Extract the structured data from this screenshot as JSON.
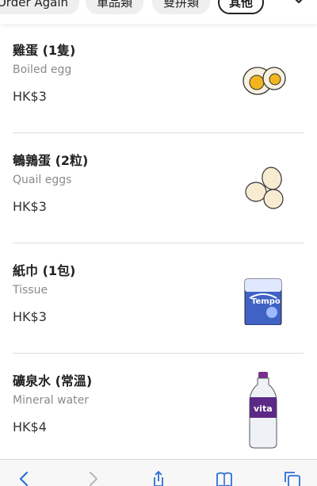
{
  "categories": {
    "tabs": [
      {
        "label": "Order Again"
      },
      {
        "label": "單品類"
      },
      {
        "label": "雙拼類"
      },
      {
        "label": "其他"
      }
    ],
    "active": "其他"
  },
  "items": [
    {
      "name_zh": "雞蛋 (1隻)",
      "name_en": "Boiled egg",
      "price": "HK$3",
      "icon": "boiled-egg-image"
    },
    {
      "name_zh": "鵪鶉蛋 (2粒)",
      "name_en": "Quail eggs",
      "price": "HK$3",
      "icon": "quail-eggs-image"
    },
    {
      "name_zh": "紙巾 (1包)",
      "name_en": "Tissue",
      "price": "HK$3",
      "icon": "tissue-pack-image"
    },
    {
      "name_zh": "礦泉水 (常溫)",
      "name_en": "Mineral water",
      "price": "HK$4",
      "icon": "water-bottle-image"
    }
  ],
  "browser_toolbar": {
    "icons": [
      "back-icon",
      "forward-icon",
      "share-icon",
      "bookmarks-icon",
      "tabs-icon"
    ]
  }
}
